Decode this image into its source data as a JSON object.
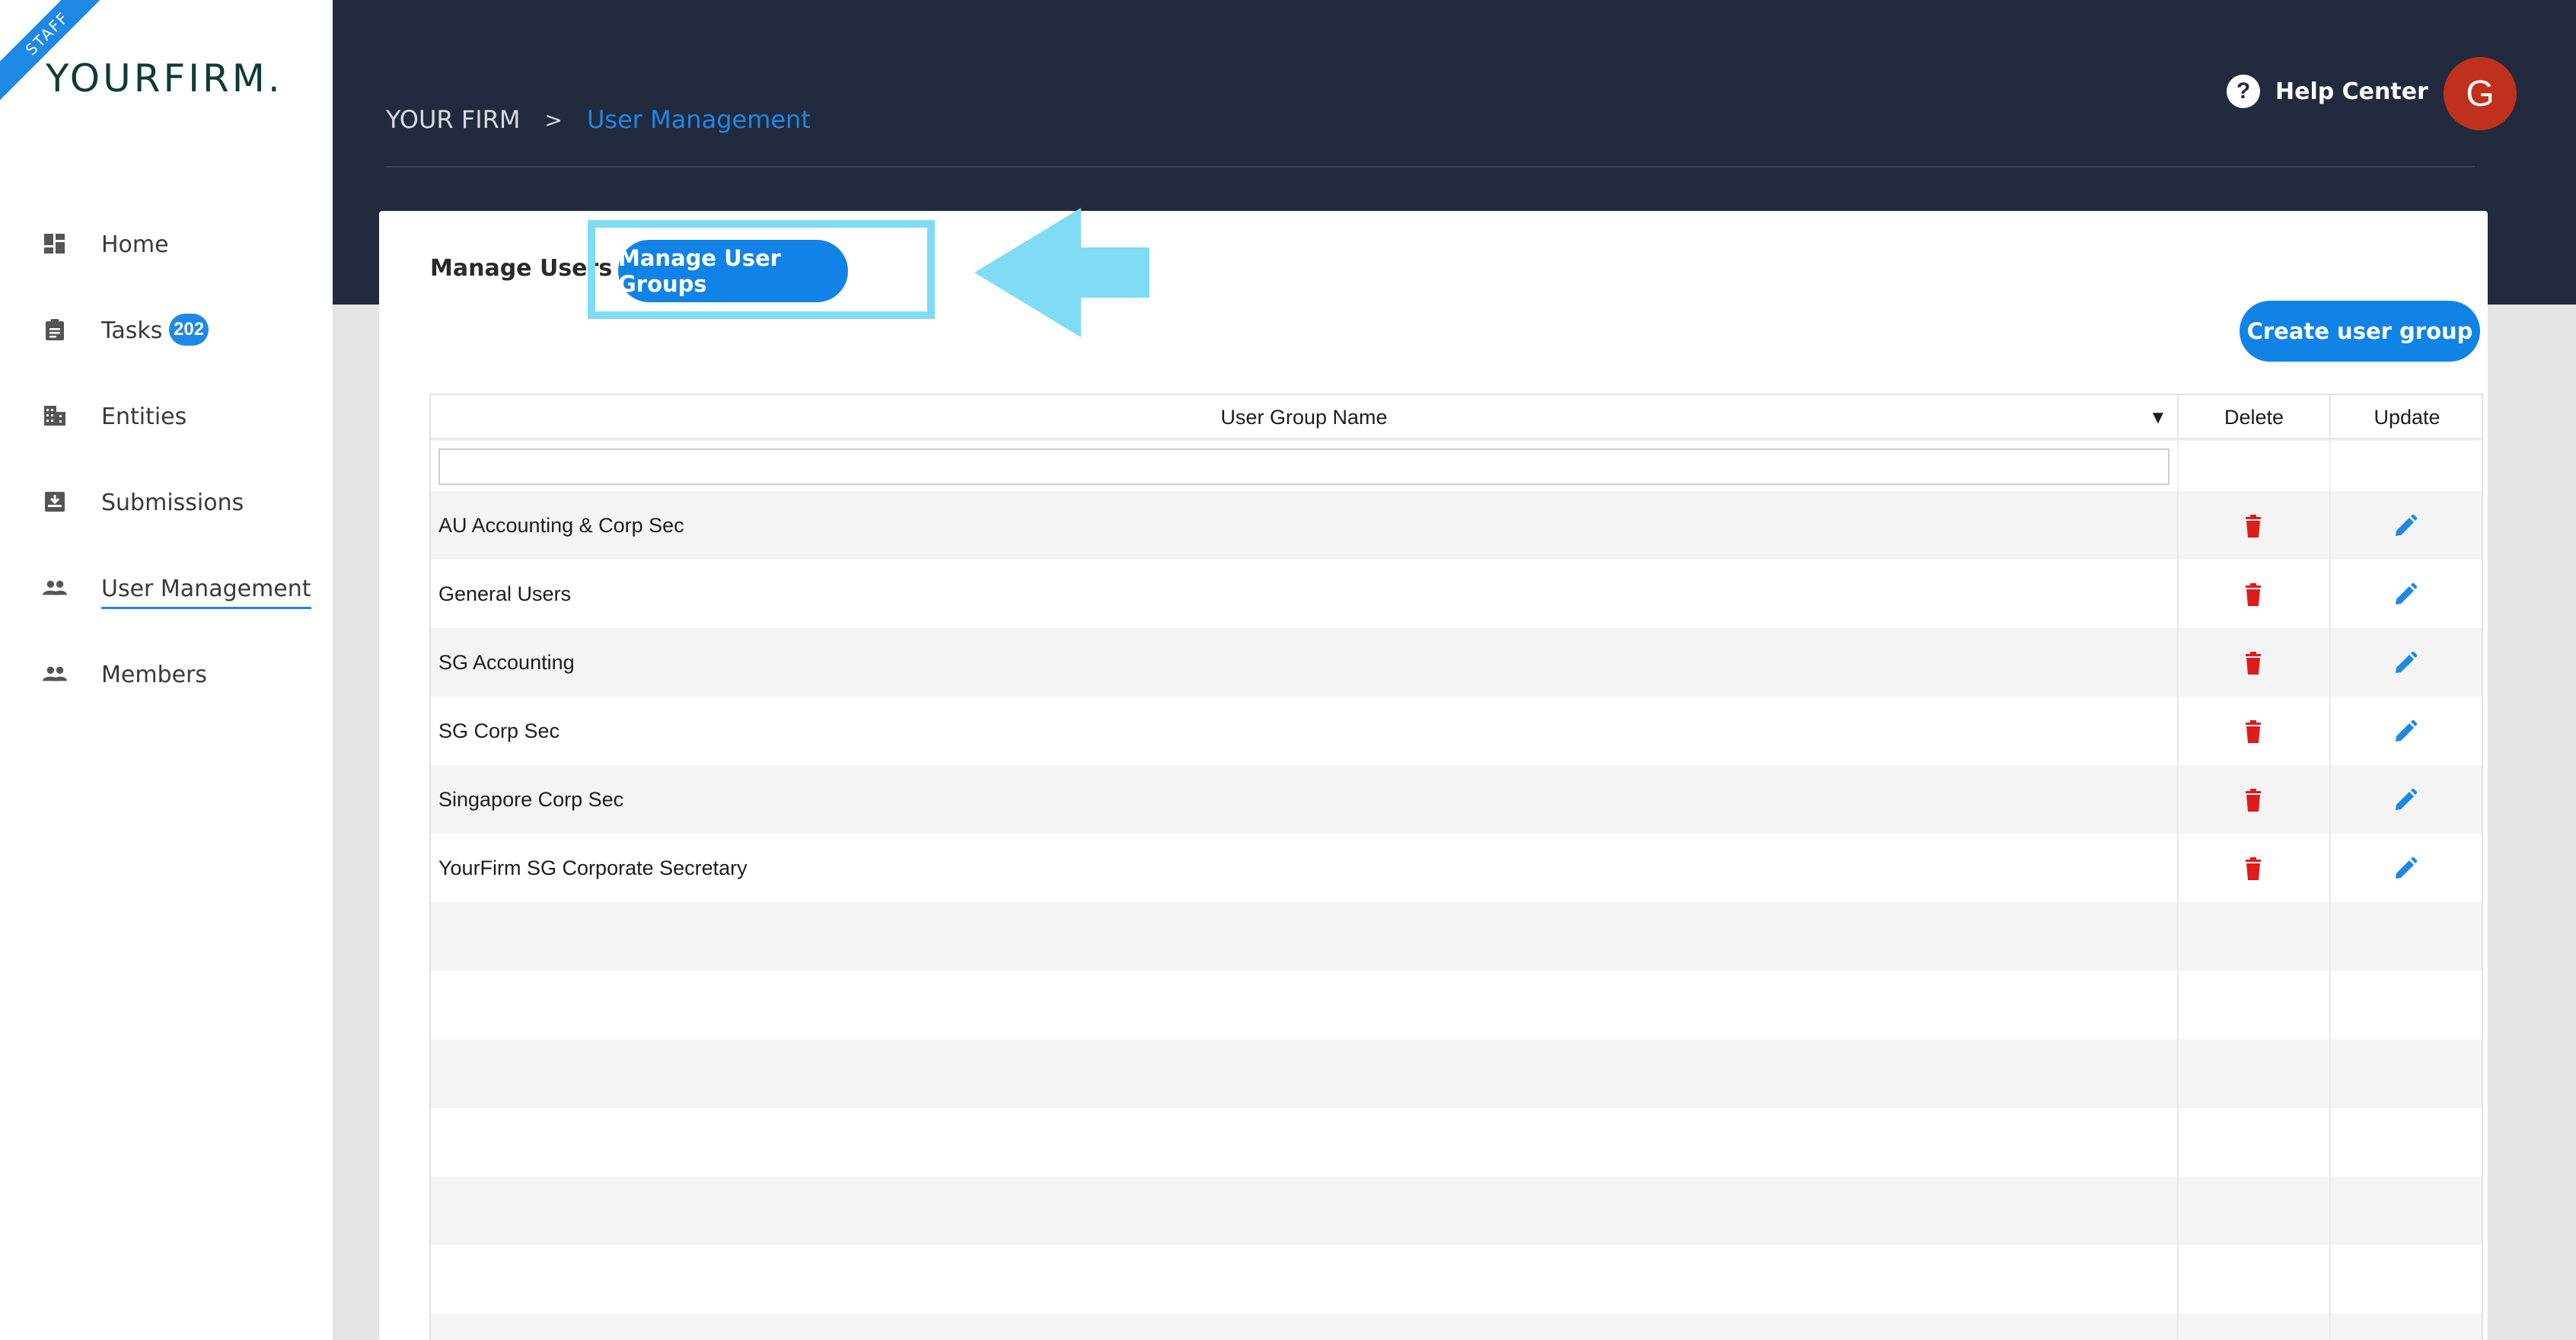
{
  "sidebar": {
    "ribbon": "STAFF",
    "logo": "YOURFIRM",
    "logo_dot": ".",
    "items": [
      {
        "label": "Home",
        "icon": "dashboard-icon"
      },
      {
        "label": "Tasks",
        "icon": "clipboard-icon",
        "badge": "202"
      },
      {
        "label": "Entities",
        "icon": "building-icon"
      },
      {
        "label": "Submissions",
        "icon": "inbox-icon"
      },
      {
        "label": "User Management",
        "icon": "people-icon",
        "active": true
      },
      {
        "label": "Members",
        "icon": "people-icon"
      }
    ]
  },
  "header": {
    "breadcrumb": {
      "root": "YOUR FIRM",
      "separator": ">",
      "current": "User Management"
    },
    "help_label": "Help Center",
    "help_icon_glyph": "?",
    "avatar_initial": "G"
  },
  "tabs": {
    "users": "Manage Users",
    "groups": "Manage User Groups"
  },
  "create_button": "Create user group",
  "table": {
    "columns": {
      "name": "User Group Name",
      "sort_glyph": "▼",
      "delete": "Delete",
      "update": "Update"
    },
    "filter_value": "",
    "rows": [
      "AU Accounting & Corp Sec",
      "General Users",
      "SG Accounting",
      "SG Corp Sec",
      "Singapore Corp Sec",
      "YourFirm SG Corporate Secretary"
    ],
    "empty_row_count": 7
  },
  "colors": {
    "header_bg": "#222a3e",
    "accent_blue": "#1283e6",
    "delete_red": "#e01b1b",
    "highlight_cyan": "#7fdcf4",
    "avatar_red": "#c0311d"
  }
}
